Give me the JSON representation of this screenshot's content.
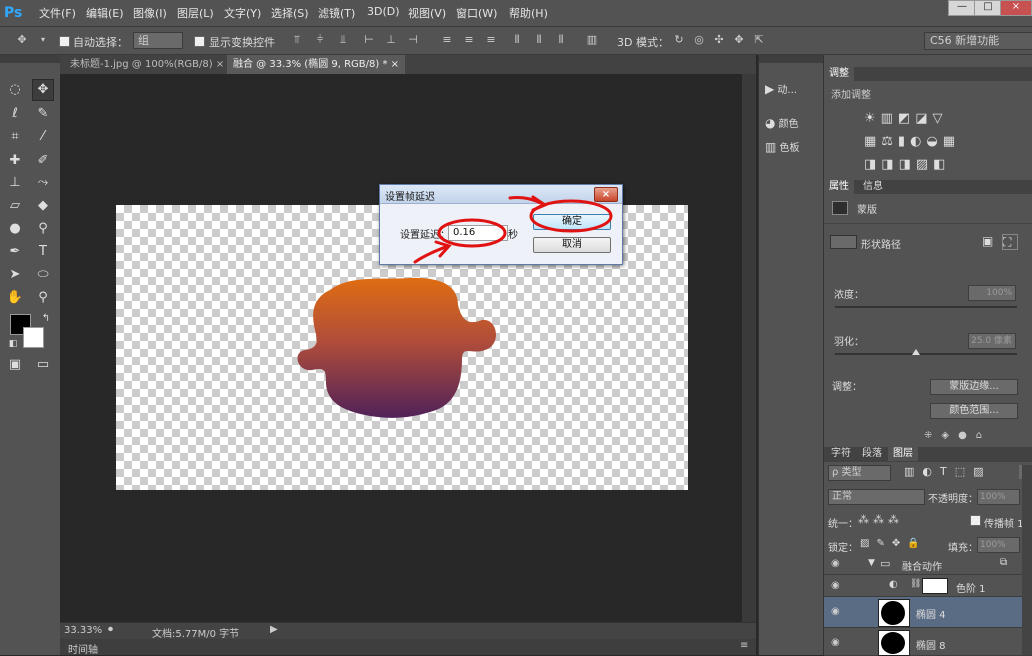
{
  "app": {
    "logo": "Ps"
  },
  "menu": [
    "文件(F)",
    "编辑(E)",
    "图像(I)",
    "图层(L)",
    "文字(Y)",
    "选择(S)",
    "滤镜(T)",
    "3D(D)",
    "视图(V)",
    "窗口(W)",
    "帮助(H)"
  ],
  "window_controls": {
    "minimize": "—",
    "maximize": "□",
    "close": "×"
  },
  "options": {
    "auto_select_label": "自动选择：",
    "auto_select_value": "组",
    "transform_controls_label": "显示变换控件",
    "mode_3d_label": "3D 模式：",
    "workspace": "C56 新增功能"
  },
  "tabs": [
    {
      "label": "未标题-1.jpg @ 100%(RGB/8)",
      "close": "×",
      "active": false
    },
    {
      "label": "融合 @ 33.3% (椭圆 9, RGB/8) *",
      "close": "×",
      "active": true
    }
  ],
  "status": {
    "zoom": "33.33%",
    "doc": "文档:5.77M/0 字节",
    "timeline": "时间轴"
  },
  "midpanel": [
    {
      "icon": "play-icon",
      "label": "动..."
    },
    {
      "icon": "palette-icon",
      "label": "颜色"
    },
    {
      "icon": "swatches-icon",
      "label": "色板"
    }
  ],
  "adjustments": {
    "tab": "调整",
    "title": "添加调整"
  },
  "properties": {
    "tabs": [
      "属性",
      "信息"
    ],
    "mask_label": "蒙版",
    "shape_path_label": "形状路径",
    "density_label": "浓度：",
    "density_value": "100%",
    "feather_label": "羽化：",
    "feather_value": "25.0 像素",
    "adjust_label": "调整：",
    "mask_edge_button": "蒙版边缘...",
    "color_range_button": "颜色范围..."
  },
  "layers": {
    "tabs": [
      "字符",
      "段落",
      "图层"
    ],
    "filter_label": "ρ 类型",
    "blend_mode": "正常",
    "opacity_label": "不透明度：",
    "opacity_value": "100%",
    "unify_label": "统一：",
    "propagate_label": "传播帧 1",
    "lock_label": "锁定：",
    "fill_label": "填充：",
    "fill_value": "100%",
    "rows": [
      {
        "name": "融合动作",
        "type": "group"
      },
      {
        "name": "色阶 1",
        "type": "adjustment"
      },
      {
        "name": "椭圆 4",
        "type": "shape"
      },
      {
        "name": "椭圆 8",
        "type": "shape"
      }
    ]
  },
  "dialog": {
    "title": "设置帧延迟",
    "close": "×",
    "delay_label": "设置延迟：",
    "delay_value": "0.16",
    "unit": "秒",
    "ok": "确定",
    "cancel": "取消"
  },
  "colors": {
    "shape_top": "#d9641e",
    "shape_bottom": "#5a2450",
    "annotation": "#e01010"
  }
}
